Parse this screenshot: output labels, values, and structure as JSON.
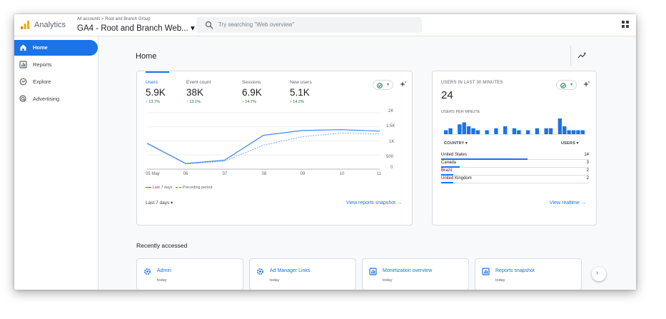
{
  "header": {
    "app_name": "Analytics",
    "breadcrumb": "All accounts  >  Root and Branch Group",
    "property": "GA4 - Root and Branch Web... ▾",
    "search_placeholder": "Try searching \"Web overview\""
  },
  "sidebar": {
    "items": [
      {
        "label": "Home",
        "icon": "home-icon",
        "active": true
      },
      {
        "label": "Reports",
        "icon": "reports-icon",
        "active": false
      },
      {
        "label": "Explore",
        "icon": "explore-icon",
        "active": false
      },
      {
        "label": "Advertising",
        "icon": "advertising-icon",
        "active": false
      }
    ]
  },
  "main": {
    "title": "Home",
    "overview": {
      "metrics": [
        {
          "label": "Users",
          "value": "5.9K",
          "delta": "↑ 13.7%"
        },
        {
          "label": "Event count",
          "value": "38K",
          "delta": "↑ 13.1%"
        },
        {
          "label": "Sessions",
          "value": "6.9K",
          "delta": "↑ 14.7%"
        },
        {
          "label": "New users",
          "value": "5.1K",
          "delta": "↑ 14.2%"
        }
      ],
      "legend_current": "Last 7 days",
      "legend_previous": "Preceding period",
      "date_range": "Last 7 days ▾",
      "link": "View reports snapshot  →"
    },
    "realtime": {
      "title": "USERS IN LAST 30 MINUTES",
      "value": "24",
      "subtitle": "USERS PER MINUTE",
      "col_country": "COUNTRY ▾",
      "col_users": "USERS ▾",
      "rows": [
        {
          "country": "United States",
          "users": "14"
        },
        {
          "country": "Canada",
          "users": "3"
        },
        {
          "country": "Brazil",
          "users": "2"
        },
        {
          "country": "United Kingdom",
          "users": "2"
        }
      ],
      "link": "View realtime  →"
    },
    "recent_title": "Recently accessed",
    "recent": [
      {
        "title": "Admin",
        "sub": "today",
        "icon": "gear-icon"
      },
      {
        "title": "Ad Manager Links",
        "sub": "today",
        "icon": "gear-icon"
      },
      {
        "title": "Monetization overview",
        "sub": "today",
        "icon": "report-icon"
      },
      {
        "title": "Reports snapshot",
        "sub": "today",
        "icon": "report-icon"
      }
    ]
  },
  "colors": {
    "accent": "#1a73e8",
    "positive": "#137333",
    "logo_orange": "#f9ab00",
    "logo_dark": "#e37400"
  },
  "chart_data": [
    {
      "type": "line",
      "x": [
        "05 May",
        "06",
        "07",
        "08",
        "09",
        "10",
        "11"
      ],
      "ylim": [
        0,
        2000
      ],
      "yticks": [
        "2K",
        "1.5K",
        "1K",
        "500",
        "0"
      ],
      "series": [
        {
          "name": "Last 7 days",
          "values": [
            920,
            200,
            320,
            1200,
            1370,
            1400,
            1350
          ]
        },
        {
          "name": "Preceding period",
          "values": [
            900,
            180,
            280,
            850,
            1150,
            1280,
            1250
          ]
        }
      ]
    },
    {
      "type": "bar",
      "values": [
        2,
        3,
        0,
        5,
        6,
        4,
        3,
        2,
        0,
        2,
        0,
        3,
        0,
        4,
        0,
        3,
        2,
        0,
        2,
        0,
        3,
        0,
        3,
        3,
        0,
        8,
        4,
        2,
        2,
        2,
        2
      ]
    }
  ]
}
